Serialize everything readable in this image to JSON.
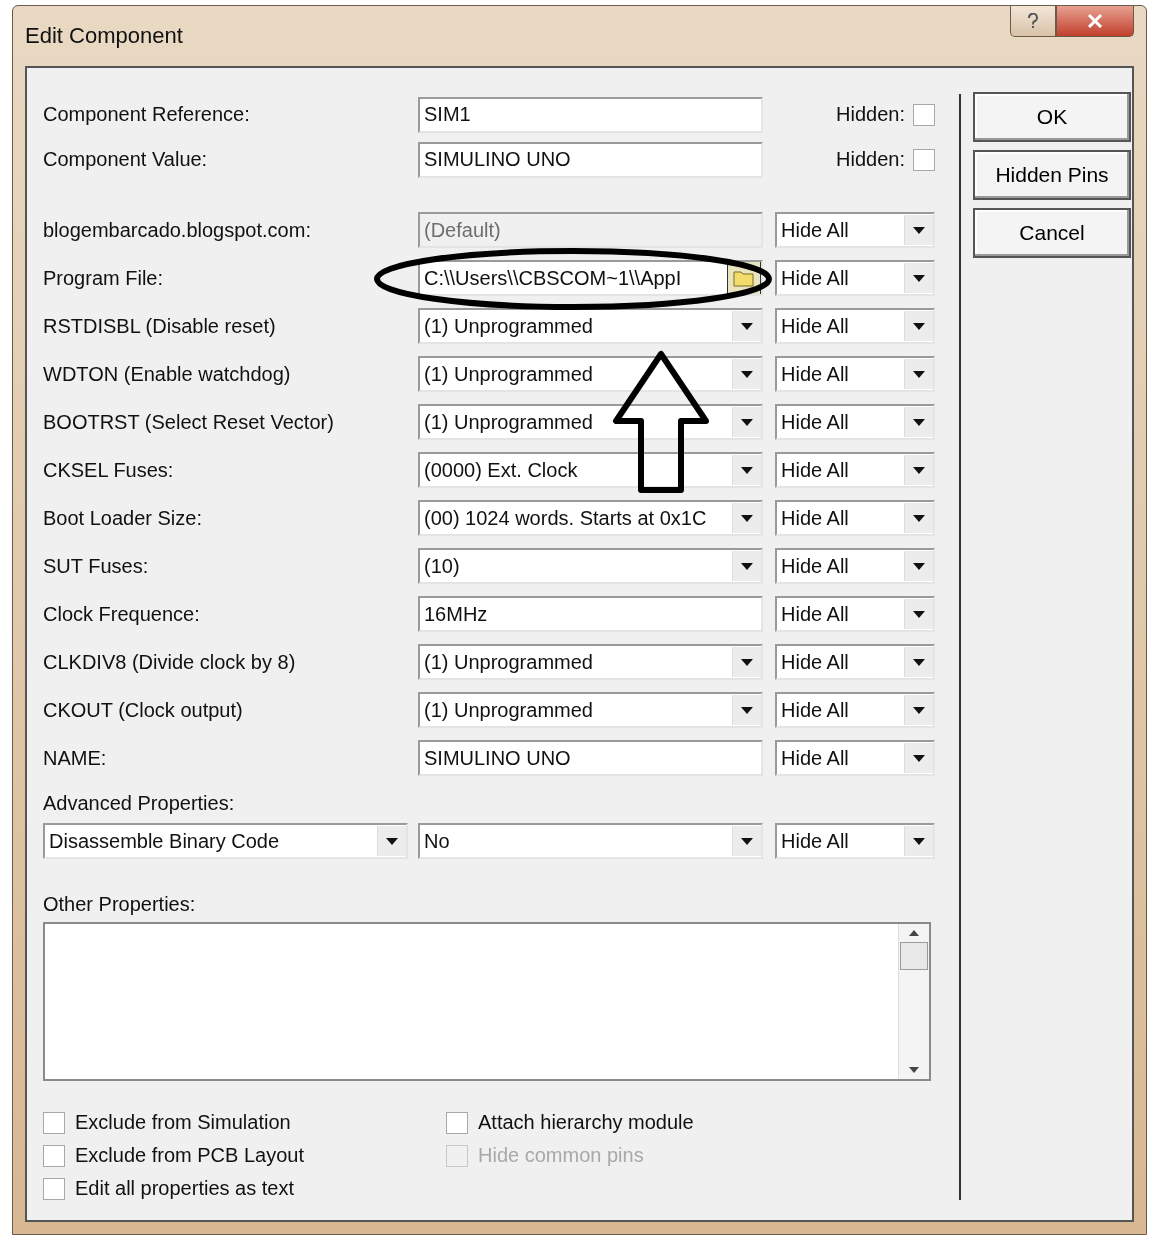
{
  "window": {
    "title": "Edit Component"
  },
  "header_rows": [
    {
      "label": "Component Reference:",
      "value": "SIM1",
      "hidden_label": "Hidden:",
      "hidden": false
    },
    {
      "label": "Component Value:",
      "value": "SIMULINO UNO",
      "hidden_label": "Hidden:",
      "hidden": false
    }
  ],
  "properties": [
    {
      "label": "blogembarcado.blogspot.com:",
      "kind": "readonly",
      "value": "(Default)",
      "visibility": "Hide All"
    },
    {
      "label": "Program File:",
      "kind": "file",
      "value": "C:\\\\Users\\\\CBSCOM~1\\\\AppI",
      "visibility": "Hide All"
    },
    {
      "label": "RSTDISBL (Disable reset)",
      "kind": "select",
      "value": "(1) Unprogrammed",
      "visibility": "Hide All"
    },
    {
      "label": "WDTON (Enable watchdog)",
      "kind": "select",
      "value": "(1) Unprogrammed",
      "visibility": "Hide All"
    },
    {
      "label": "BOOTRST (Select Reset Vector)",
      "kind": "select",
      "value": "(1) Unprogrammed",
      "visibility": "Hide All"
    },
    {
      "label": "CKSEL Fuses:",
      "kind": "select",
      "value": "(0000) Ext. Clock",
      "visibility": "Hide All"
    },
    {
      "label": "Boot Loader Size:",
      "kind": "select",
      "value": "(00) 1024 words. Starts at 0x1C",
      "visibility": "Hide All"
    },
    {
      "label": "SUT Fuses:",
      "kind": "select",
      "value": "(10)",
      "visibility": "Hide All"
    },
    {
      "label": "Clock Frequence:",
      "kind": "text",
      "value": "16MHz",
      "visibility": "Hide All"
    },
    {
      "label": "CLKDIV8 (Divide clock by 8)",
      "kind": "select",
      "value": "(1) Unprogrammed",
      "visibility": "Hide All"
    },
    {
      "label": "CKOUT (Clock output)",
      "kind": "select",
      "value": "(1) Unprogrammed",
      "visibility": "Hide All"
    },
    {
      "label": "NAME:",
      "kind": "text",
      "value": "SIMULINO UNO",
      "visibility": "Hide All"
    }
  ],
  "advanced": {
    "label": "Advanced Properties:",
    "property": "Disassemble Binary Code",
    "value": "No",
    "visibility": "Hide All"
  },
  "other": {
    "label": "Other Properties:"
  },
  "options_left": [
    {
      "label": "Exclude from Simulation",
      "checked": false,
      "disabled": false
    },
    {
      "label": "Exclude from PCB Layout",
      "checked": false,
      "disabled": false
    },
    {
      "label": "Edit all properties as text",
      "checked": false,
      "disabled": false
    }
  ],
  "options_right": [
    {
      "label": "Attach hierarchy module",
      "checked": false,
      "disabled": false
    },
    {
      "label": "Hide common pins",
      "checked": false,
      "disabled": true
    }
  ],
  "buttons": [
    "OK",
    "Hidden Pins",
    "Cancel"
  ]
}
